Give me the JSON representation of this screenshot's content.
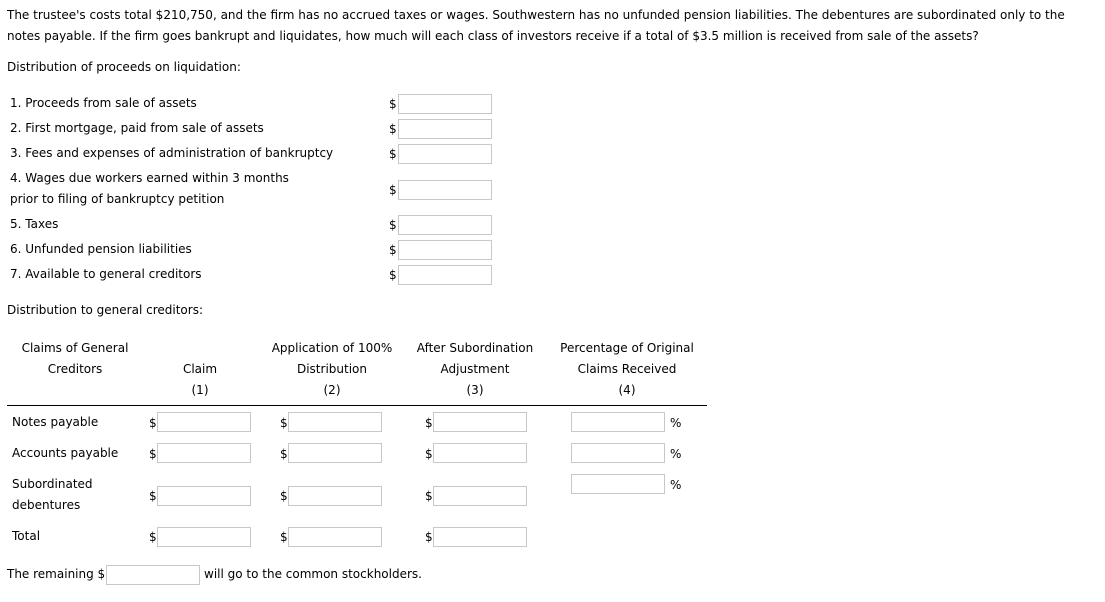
{
  "question": {
    "text": "The trustee's costs total $210,750, and the firm has no accrued taxes or wages. Southwestern has no unfunded pension liabilities. The debentures are subordinated only to the notes payable. If the firm goes bankrupt and liquidates, how much will each class of investors receive if a total of $3.5 million is received from sale of the assets?"
  },
  "liquidation": {
    "heading": "Distribution of proceeds on liquidation:",
    "currency_symbol": "$",
    "items": [
      {
        "label": "1. Proceeds from sale of assets",
        "value": ""
      },
      {
        "label": "2. First mortgage, paid from sale of assets",
        "value": ""
      },
      {
        "label": "3. Fees and expenses of administration of bankruptcy",
        "value": ""
      },
      {
        "label_line1": "4. Wages due workers earned within 3 months",
        "label_line2": "prior to filing of bankruptcy petition",
        "value": ""
      },
      {
        "label": "5. Taxes",
        "value": ""
      },
      {
        "label": "6. Unfunded pension liabilities",
        "value": ""
      },
      {
        "label": "7. Available to general creditors",
        "value": ""
      }
    ]
  },
  "general_creditors": {
    "heading": "Distribution to general creditors:",
    "currency_symbol": "$",
    "percent_symbol": "%",
    "columns": [
      {
        "line1": "Claims of General",
        "line2": "Creditors",
        "line3": ""
      },
      {
        "line1": "",
        "line2": "Claim",
        "line3": "(1)"
      },
      {
        "line1": "Application of 100%",
        "line2": "Distribution",
        "line3": "(2)"
      },
      {
        "line1": "After Subordination",
        "line2": "Adjustment",
        "line3": "(3)"
      },
      {
        "line1": "Percentage of Original",
        "line2": "Claims Received",
        "line3": "(4)"
      }
    ],
    "rows": [
      {
        "label": "Notes payable",
        "claim": "",
        "distribution": "",
        "adjustment": "",
        "percentage": ""
      },
      {
        "label": "Accounts payable",
        "claim": "",
        "distribution": "",
        "adjustment": "",
        "percentage": ""
      },
      {
        "label_line1": "Subordinated",
        "label_line2": "debentures",
        "claim": "",
        "distribution": "",
        "adjustment": "",
        "percentage": ""
      },
      {
        "label": "Total",
        "claim": "",
        "distribution": "",
        "adjustment": ""
      }
    ]
  },
  "remaining": {
    "prefix": "The remaining $",
    "value": "",
    "suffix": "will go to the common stockholders."
  }
}
